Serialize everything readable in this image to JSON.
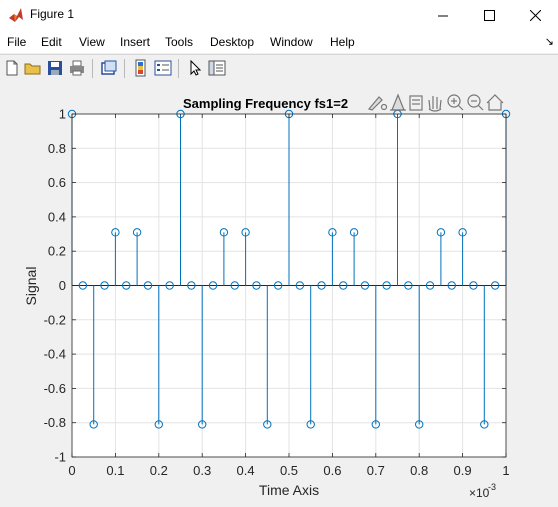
{
  "window": {
    "title": "Figure 1",
    "minimize_label": "—",
    "maximize_label": "☐",
    "close_label": "✕"
  },
  "menu": {
    "items": [
      "File",
      "Edit",
      "View",
      "Insert",
      "Tools",
      "Desktop",
      "Window",
      "Help"
    ]
  },
  "axes_toolbar": {
    "icons": [
      "brush-icon",
      "data-tip-icon",
      "export-icon",
      "pan-icon",
      "zoom-in-icon",
      "zoom-out-icon",
      "home-icon"
    ]
  },
  "colors": {
    "stem": "#0072bd",
    "grid": "#e3e3e3",
    "axes_bg": "#ffffff"
  },
  "chart_data": {
    "type": "stem",
    "title": "Sampling Frequency fs1=2",
    "xlabel": "Time Axis",
    "ylabel": "Signal",
    "x_exponent_label": "×10",
    "x_exponent_power": "-3",
    "xlim": [
      0,
      1
    ],
    "ylim": [
      -1,
      1
    ],
    "xticks": [
      0,
      0.1,
      0.2,
      0.3,
      0.4,
      0.5,
      0.6,
      0.7,
      0.8,
      0.9,
      1
    ],
    "xtick_labels": [
      "0",
      "0.1",
      "0.2",
      "0.3",
      "0.4",
      "0.5",
      "0.6",
      "0.7",
      "0.8",
      "0.9",
      "1"
    ],
    "yticks": [
      -1,
      -0.8,
      -0.6,
      -0.4,
      -0.2,
      0,
      0.2,
      0.4,
      0.6,
      0.8,
      1
    ],
    "ytick_labels": [
      "-1",
      "-0.8",
      "-0.6",
      "-0.4",
      "-0.2",
      "0",
      "0.2",
      "0.4",
      "0.6",
      "0.8",
      "1"
    ],
    "grid": true,
    "x": [
      0,
      0.025,
      0.05,
      0.075,
      0.1,
      0.125,
      0.15,
      0.175,
      0.2,
      0.225,
      0.25,
      0.275,
      0.3,
      0.325,
      0.35,
      0.375,
      0.4,
      0.425,
      0.45,
      0.475,
      0.5,
      0.525,
      0.55,
      0.575,
      0.6,
      0.625,
      0.65,
      0.675,
      0.7,
      0.725,
      0.75,
      0.775,
      0.8,
      0.825,
      0.85,
      0.875,
      0.9,
      0.925,
      0.95,
      0.975,
      1
    ],
    "y": [
      1,
      0,
      -0.81,
      0,
      0.31,
      0,
      0.31,
      0,
      -0.81,
      0,
      1,
      0,
      -0.81,
      0,
      0.31,
      0,
      0.31,
      0,
      -0.81,
      0,
      1,
      0,
      -0.81,
      0,
      0.31,
      0,
      0.31,
      0,
      -0.81,
      0,
      1,
      0,
      -0.81,
      0,
      0.31,
      0,
      0.31,
      0,
      -0.81,
      0,
      1
    ]
  }
}
